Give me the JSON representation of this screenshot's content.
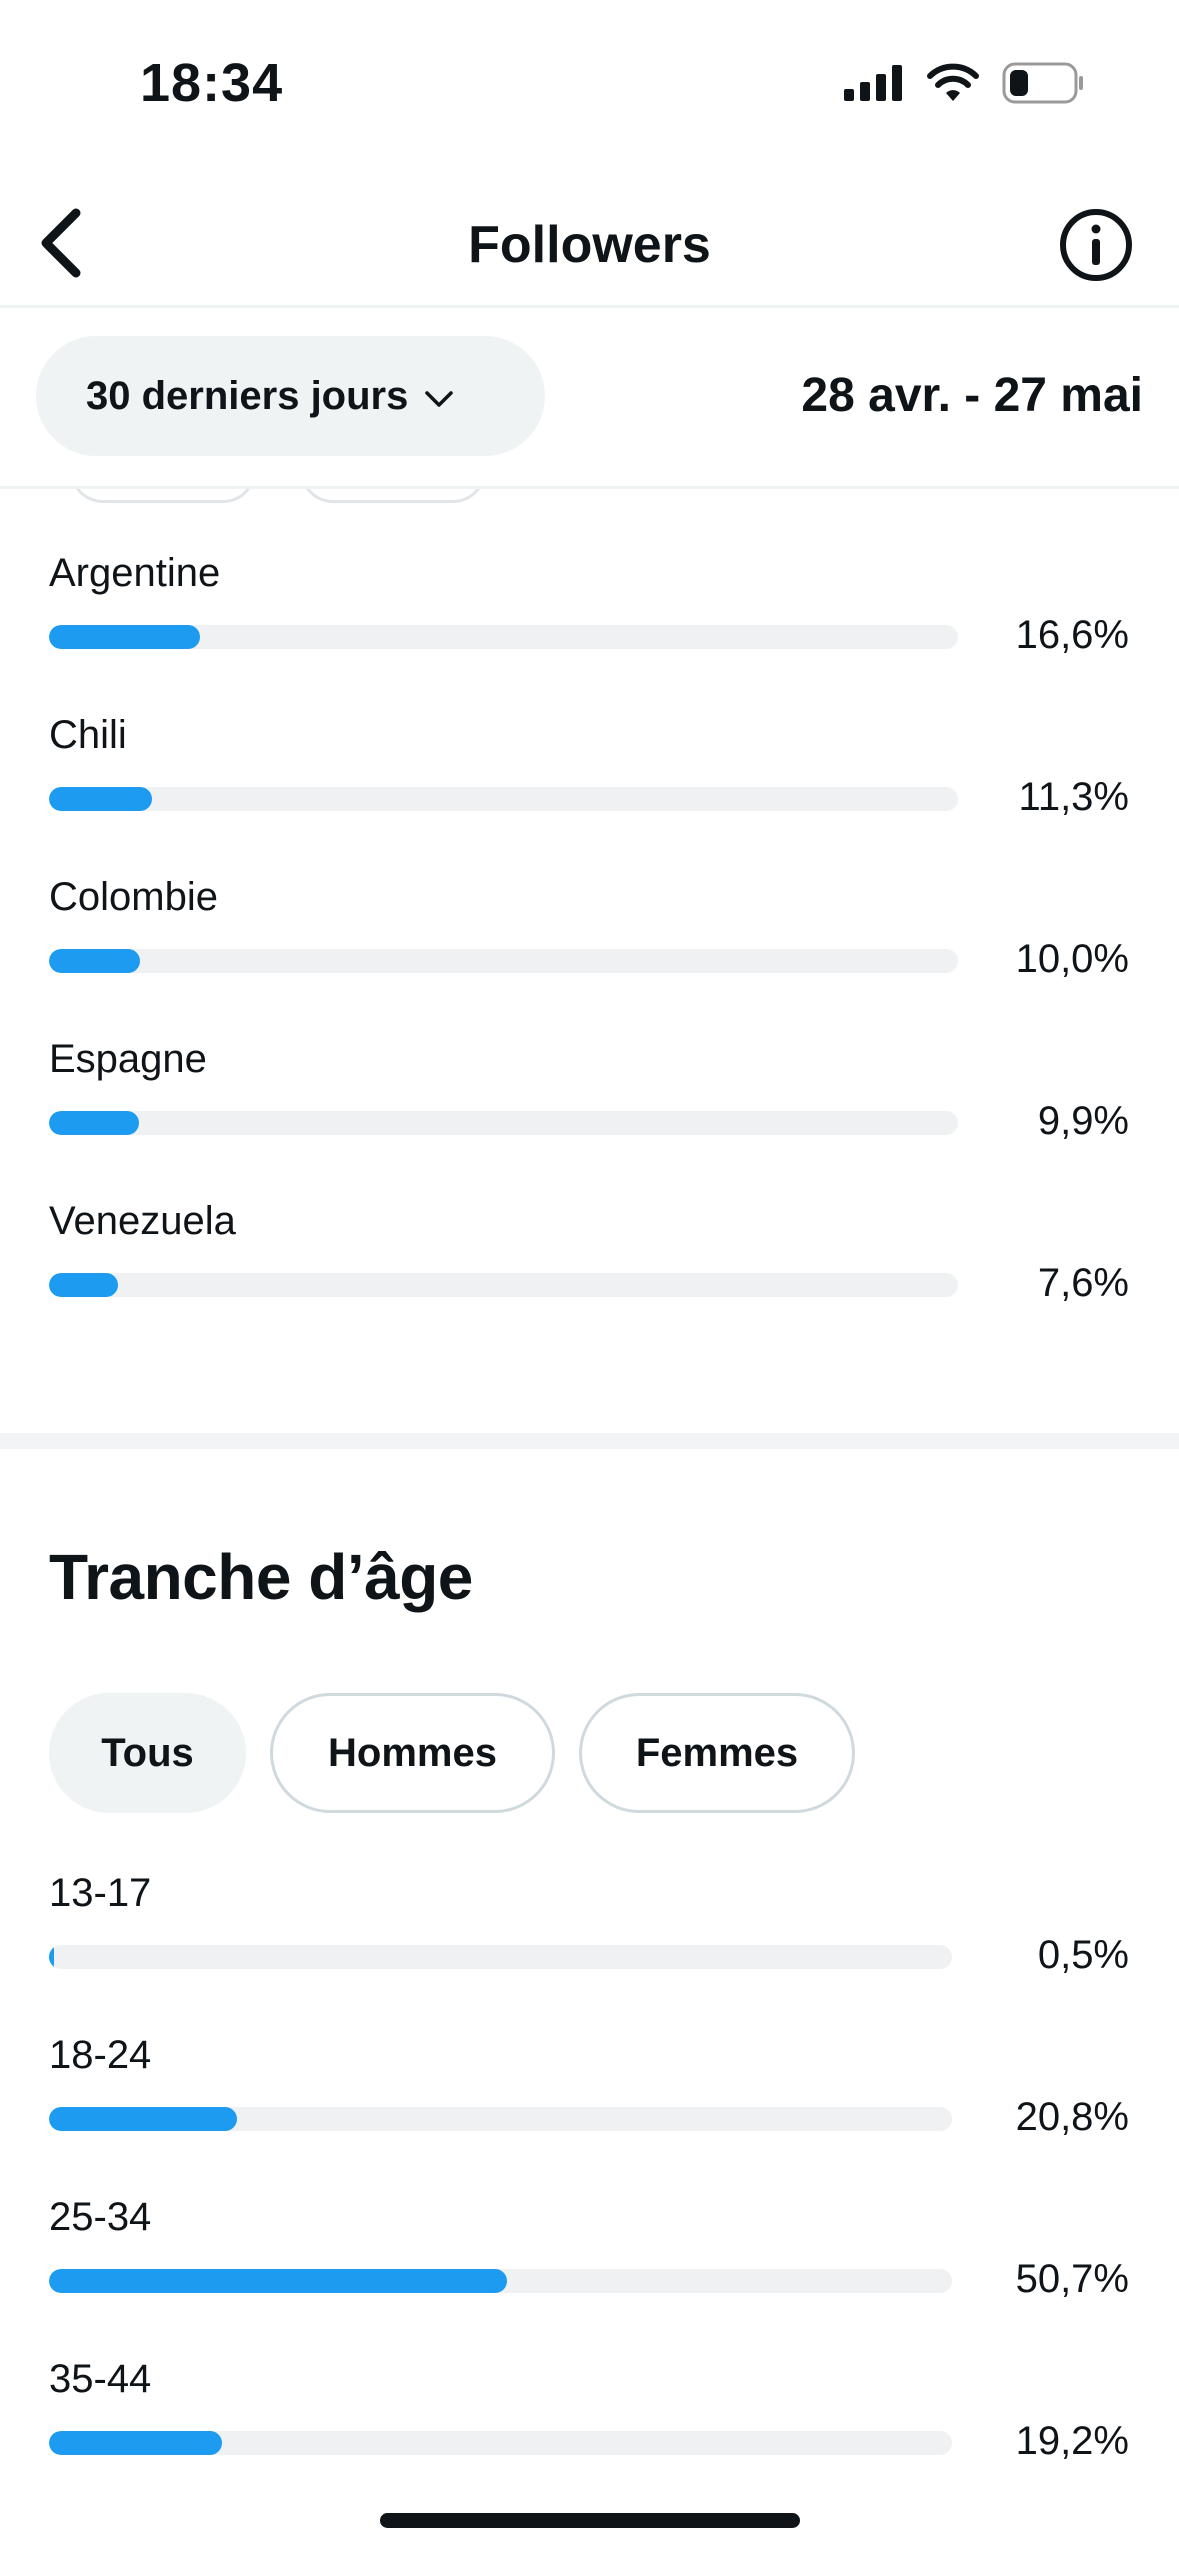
{
  "status_bar": {
    "time": "18:34",
    "battery_level": 0.25
  },
  "header": {
    "title": "Followers"
  },
  "filter": {
    "range_label": "30 derniers jours",
    "date_range": "28 avr. - 27 mai"
  },
  "countries": [
    {
      "label": "Argentine",
      "value": "16,6%",
      "fraction": 0.166
    },
    {
      "label": "Chili",
      "value": "11,3%",
      "fraction": 0.113
    },
    {
      "label": "Colombie",
      "value": "10,0%",
      "fraction": 0.1
    },
    {
      "label": "Espagne",
      "value": "9,9%",
      "fraction": 0.099
    },
    {
      "label": "Venezuela",
      "value": "7,6%",
      "fraction": 0.076
    }
  ],
  "age_section": {
    "title": "Tranche d’âge",
    "chips": [
      {
        "label": "Tous",
        "active": true
      },
      {
        "label": "Hommes",
        "active": false
      },
      {
        "label": "Femmes",
        "active": false
      }
    ],
    "rows": [
      {
        "label": "13-17",
        "value": "0,5%",
        "fraction": 0.005
      },
      {
        "label": "18-24",
        "value": "20,8%",
        "fraction": 0.208
      },
      {
        "label": "25-34",
        "value": "50,7%",
        "fraction": 0.507
      },
      {
        "label": "35-44",
        "value": "19,2%",
        "fraction": 0.192
      }
    ]
  },
  "colors": {
    "accent": "#1d9bf0",
    "track": "#eff1f2",
    "text": "#0f1419"
  }
}
